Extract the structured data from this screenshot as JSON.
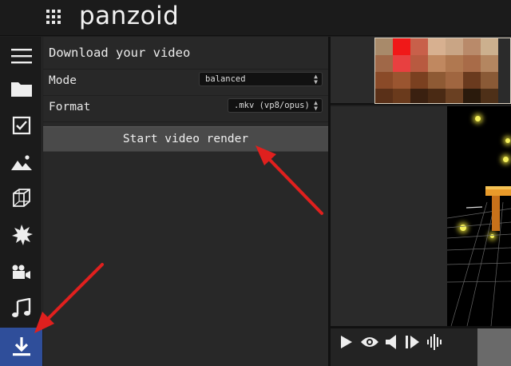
{
  "app": {
    "brand": "panzoid"
  },
  "sidebar": {
    "items": [
      {
        "icon": "menu-icon"
      },
      {
        "icon": "folder-icon"
      },
      {
        "icon": "checkbox-icon"
      },
      {
        "icon": "image-icon"
      },
      {
        "icon": "cube-icon"
      },
      {
        "icon": "burst-icon"
      },
      {
        "icon": "camera-icon"
      },
      {
        "icon": "music-icon"
      },
      {
        "icon": "download-icon",
        "active": true
      }
    ]
  },
  "panel": {
    "title": "Download your video",
    "mode_label": "Mode",
    "mode_value": "balanced",
    "format_label": "Format",
    "format_value": ".mkv (vp8/opus)",
    "render_button": "Start video render"
  },
  "transport": {
    "icons": [
      "play-icon",
      "eye-icon",
      "volume-icon",
      "skip-icon",
      "waveform-icon"
    ]
  },
  "colors": {
    "accent": "#2f4e9a",
    "annotation_arrow": "#e0201e",
    "particle": "#f4f05a"
  }
}
